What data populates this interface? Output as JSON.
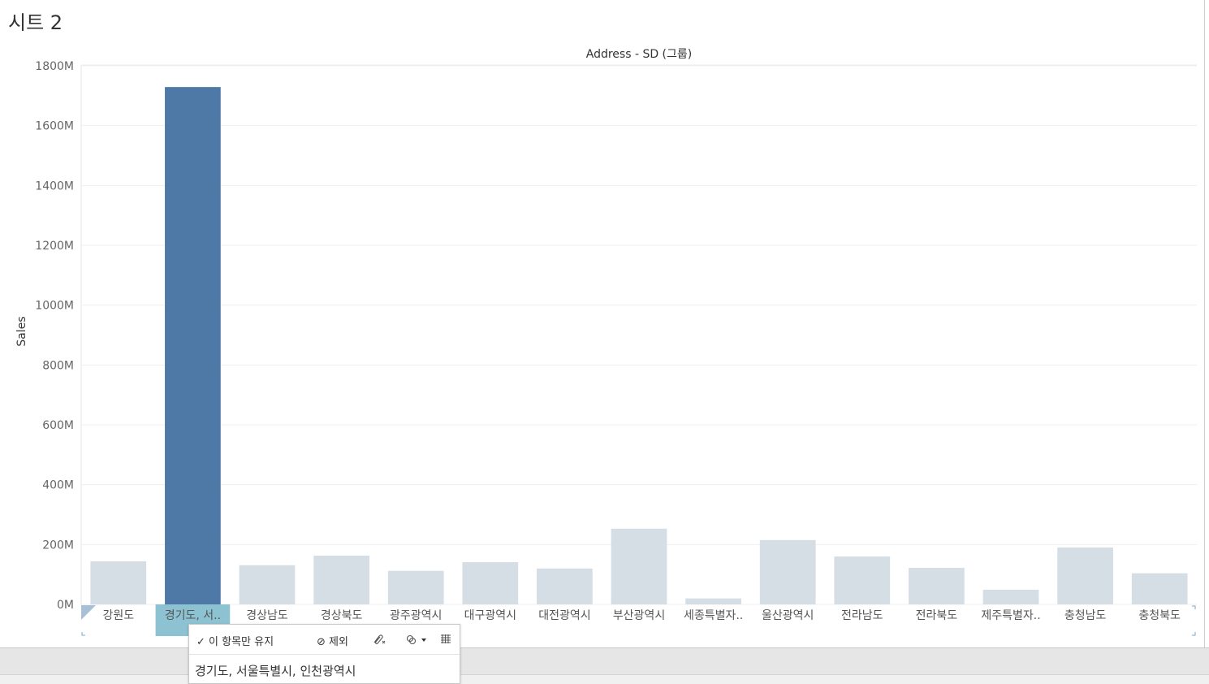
{
  "sheet": {
    "title": "시트 2"
  },
  "chart_data": {
    "type": "bar",
    "title": "Address - SD (그룹)",
    "xlabel": "",
    "ylabel": "Sales",
    "ylim": [
      0,
      1800
    ],
    "y_ticks": [
      "0M",
      "200M",
      "400M",
      "600M",
      "800M",
      "1000M",
      "1200M",
      "1400M",
      "1600M",
      "1800M"
    ],
    "categories": [
      "강원도",
      "경기도, 서..",
      "경상남도",
      "경상북도",
      "광주광역시",
      "대구광역시",
      "대전광역시",
      "부산광역시",
      "세종특별자..",
      "울산광역시",
      "전라남도",
      "전라북도",
      "제주특별자..",
      "충청남도",
      "충청북도"
    ],
    "values": [
      144,
      1729,
      131,
      163,
      112,
      141,
      120,
      253,
      20,
      215,
      160,
      122,
      49,
      190,
      104
    ],
    "selected_index": 1,
    "grid": true,
    "colors": {
      "selected": "#4e79a7",
      "unselected": "#d5dde5",
      "selected_label_bg": "#8cc2d1"
    }
  },
  "tooltip": {
    "keep_only": "✓ 이 항목만 유지",
    "exclude": "⊘ 제외",
    "selected_value": "경기도, 서울특별시, 인천광역시"
  }
}
